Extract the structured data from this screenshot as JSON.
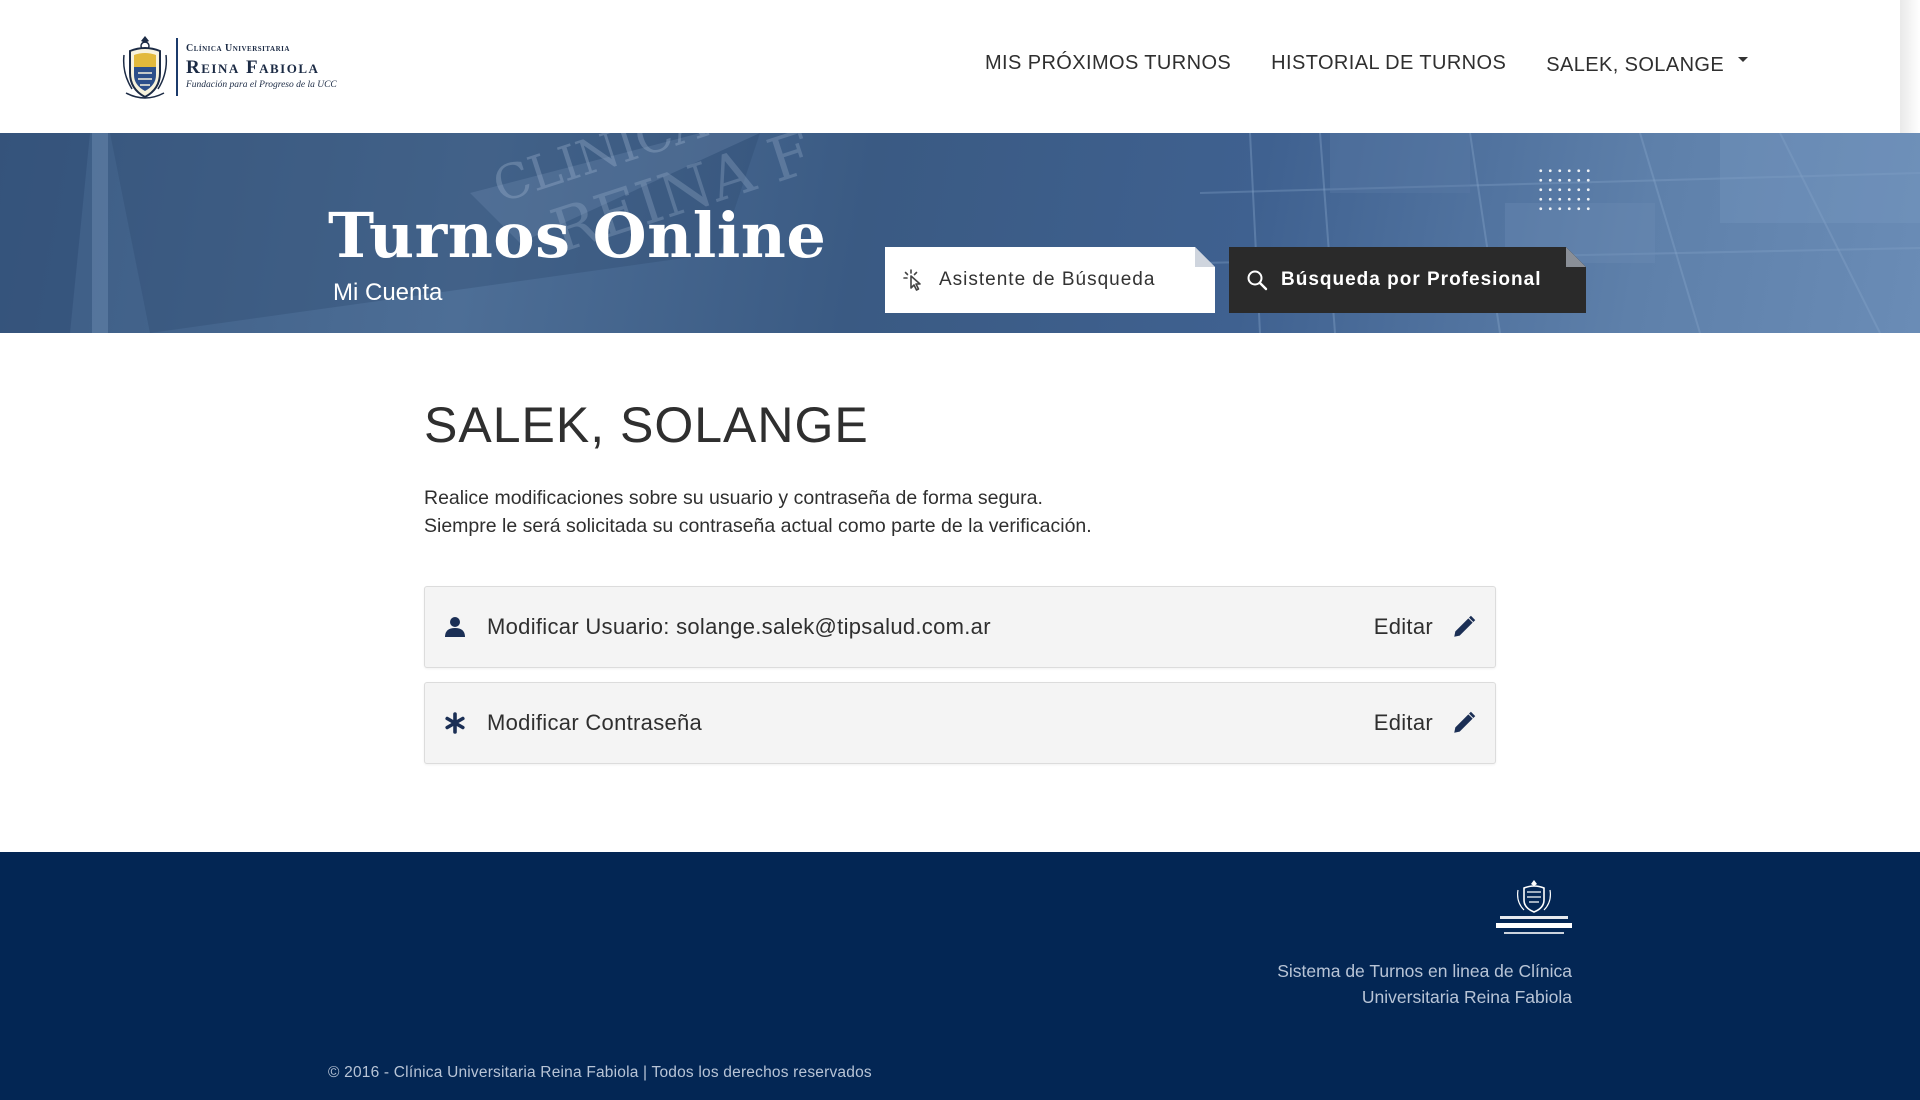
{
  "header": {
    "logo": {
      "line1": "Clínica Universitaria",
      "line2": "Reina Fabiola",
      "line3": "Fundación para el Progreso de la UCC",
      "crest_icon": "clinic-crest-icon"
    },
    "nav": {
      "upcoming_label": "MIS PRÓXIMOS TURNOS",
      "history_label": "HISTORIAL DE TURNOS",
      "user_label": "SALEK, SOLANGE",
      "user_icon": "caret-down-icon"
    }
  },
  "banner": {
    "title": "Turnos Online",
    "subtitle": "Mi Cuenta",
    "assistant_button": {
      "label": "Asistente de Búsqueda",
      "icon": "pointer-click-icon"
    },
    "professional_button": {
      "label": "Búsqueda por Profesional",
      "icon": "search-icon"
    }
  },
  "main": {
    "title": "SALEK, SOLANGE",
    "intro_line1": "Realice modificaciones sobre su usuario y contraseña de forma segura.",
    "intro_line2": "Siempre le será solicitada su contraseña actual como parte de la verificación.",
    "cards": [
      {
        "label": "Modificar Usuario: solange.salek@tipsalud.com.ar",
        "icon": "user-icon",
        "edit_label": "Editar",
        "edit_icon": "pencil-icon"
      },
      {
        "label": "Modificar Contraseña",
        "icon": "asterisk-icon",
        "edit_label": "Editar",
        "edit_icon": "pencil-icon"
      }
    ]
  },
  "footer": {
    "description_line1": "Sistema de Turnos en linea de Clínica",
    "description_line2": "Universitaria Reina Fabiola",
    "copyright": "© 2016 - Clínica Universitaria Reina Fabiola | Todos los derechos reservados"
  },
  "colors": {
    "brand_navy": "#032654",
    "banner_blue": "#4d6e96",
    "dark_button": "#2a2a2a",
    "card_bg": "#f4f4f4",
    "icon_navy": "#1b2f55"
  }
}
